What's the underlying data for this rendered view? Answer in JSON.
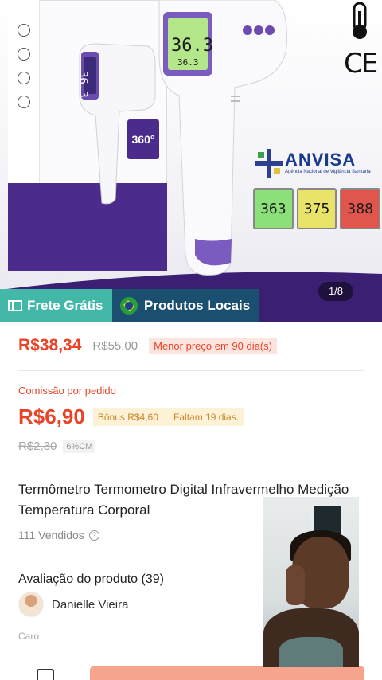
{
  "hero": {
    "pager": "1/8",
    "badge_360": "360°",
    "anvisa_title": "ANVISA",
    "anvisa_subtitle": "Agência Nacional de Vigilância Sanitária",
    "screens": [
      "363",
      "375",
      "388"
    ],
    "big_display": "36.3°",
    "big_display_sub": "36.3"
  },
  "tags": {
    "frete": "Frete Grátis",
    "locais": "Produtos Locais"
  },
  "price": {
    "main": "R$38,34",
    "old": "R$55,00",
    "chip": "Menor preço em 90 dia(s)"
  },
  "comissao": {
    "label": "Comissão por pedido",
    "value": "R$6,90",
    "bonus": "Bônus R$4,60",
    "faltam": "Faltam 19 dias.",
    "old": "R$2,30",
    "cm": "6%CM"
  },
  "product": {
    "title": "Termômetro Termometro Digital Infravermelho Medição Temperatura Corporal",
    "sold": "111 Vendidos"
  },
  "rating": {
    "title": "Avaliação do produto (39)",
    "reviewer": "Danielle Vieira",
    "note": "Caro"
  },
  "colors": {
    "accent": "#e8442a",
    "frete_bg": "#44b8a8",
    "locais_bg": "#1b4f70",
    "brand_purple": "#4b2b8c"
  },
  "icons": [
    "thermometer-icon",
    "ce-mark-icon",
    "info-icon",
    "truck-icon",
    "brazil-flag-icon"
  ]
}
